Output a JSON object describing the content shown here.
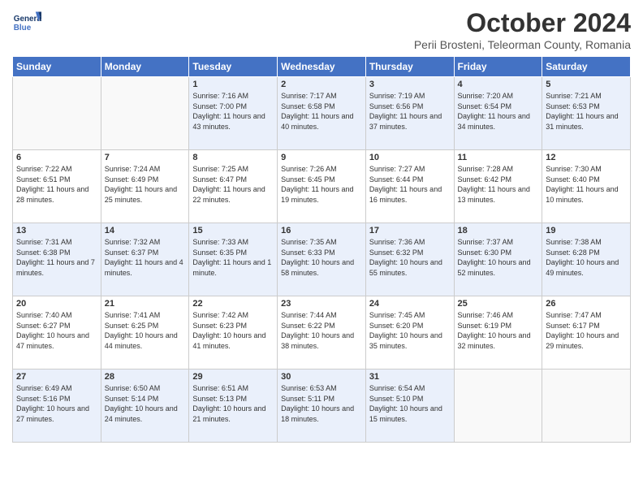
{
  "header": {
    "logo_line1": "General",
    "logo_line2": "Blue",
    "month_title": "October 2024",
    "subtitle": "Perii Brosteni, Teleorman County, Romania"
  },
  "days_of_week": [
    "Sunday",
    "Monday",
    "Tuesday",
    "Wednesday",
    "Thursday",
    "Friday",
    "Saturday"
  ],
  "weeks": [
    [
      {
        "day": "",
        "info": ""
      },
      {
        "day": "",
        "info": ""
      },
      {
        "day": "1",
        "info": "Sunrise: 7:16 AM\nSunset: 7:00 PM\nDaylight: 11 hours and 43 minutes."
      },
      {
        "day": "2",
        "info": "Sunrise: 7:17 AM\nSunset: 6:58 PM\nDaylight: 11 hours and 40 minutes."
      },
      {
        "day": "3",
        "info": "Sunrise: 7:19 AM\nSunset: 6:56 PM\nDaylight: 11 hours and 37 minutes."
      },
      {
        "day": "4",
        "info": "Sunrise: 7:20 AM\nSunset: 6:54 PM\nDaylight: 11 hours and 34 minutes."
      },
      {
        "day": "5",
        "info": "Sunrise: 7:21 AM\nSunset: 6:53 PM\nDaylight: 11 hours and 31 minutes."
      }
    ],
    [
      {
        "day": "6",
        "info": "Sunrise: 7:22 AM\nSunset: 6:51 PM\nDaylight: 11 hours and 28 minutes."
      },
      {
        "day": "7",
        "info": "Sunrise: 7:24 AM\nSunset: 6:49 PM\nDaylight: 11 hours and 25 minutes."
      },
      {
        "day": "8",
        "info": "Sunrise: 7:25 AM\nSunset: 6:47 PM\nDaylight: 11 hours and 22 minutes."
      },
      {
        "day": "9",
        "info": "Sunrise: 7:26 AM\nSunset: 6:45 PM\nDaylight: 11 hours and 19 minutes."
      },
      {
        "day": "10",
        "info": "Sunrise: 7:27 AM\nSunset: 6:44 PM\nDaylight: 11 hours and 16 minutes."
      },
      {
        "day": "11",
        "info": "Sunrise: 7:28 AM\nSunset: 6:42 PM\nDaylight: 11 hours and 13 minutes."
      },
      {
        "day": "12",
        "info": "Sunrise: 7:30 AM\nSunset: 6:40 PM\nDaylight: 11 hours and 10 minutes."
      }
    ],
    [
      {
        "day": "13",
        "info": "Sunrise: 7:31 AM\nSunset: 6:38 PM\nDaylight: 11 hours and 7 minutes."
      },
      {
        "day": "14",
        "info": "Sunrise: 7:32 AM\nSunset: 6:37 PM\nDaylight: 11 hours and 4 minutes."
      },
      {
        "day": "15",
        "info": "Sunrise: 7:33 AM\nSunset: 6:35 PM\nDaylight: 11 hours and 1 minute."
      },
      {
        "day": "16",
        "info": "Sunrise: 7:35 AM\nSunset: 6:33 PM\nDaylight: 10 hours and 58 minutes."
      },
      {
        "day": "17",
        "info": "Sunrise: 7:36 AM\nSunset: 6:32 PM\nDaylight: 10 hours and 55 minutes."
      },
      {
        "day": "18",
        "info": "Sunrise: 7:37 AM\nSunset: 6:30 PM\nDaylight: 10 hours and 52 minutes."
      },
      {
        "day": "19",
        "info": "Sunrise: 7:38 AM\nSunset: 6:28 PM\nDaylight: 10 hours and 49 minutes."
      }
    ],
    [
      {
        "day": "20",
        "info": "Sunrise: 7:40 AM\nSunset: 6:27 PM\nDaylight: 10 hours and 47 minutes."
      },
      {
        "day": "21",
        "info": "Sunrise: 7:41 AM\nSunset: 6:25 PM\nDaylight: 10 hours and 44 minutes."
      },
      {
        "day": "22",
        "info": "Sunrise: 7:42 AM\nSunset: 6:23 PM\nDaylight: 10 hours and 41 minutes."
      },
      {
        "day": "23",
        "info": "Sunrise: 7:44 AM\nSunset: 6:22 PM\nDaylight: 10 hours and 38 minutes."
      },
      {
        "day": "24",
        "info": "Sunrise: 7:45 AM\nSunset: 6:20 PM\nDaylight: 10 hours and 35 minutes."
      },
      {
        "day": "25",
        "info": "Sunrise: 7:46 AM\nSunset: 6:19 PM\nDaylight: 10 hours and 32 minutes."
      },
      {
        "day": "26",
        "info": "Sunrise: 7:47 AM\nSunset: 6:17 PM\nDaylight: 10 hours and 29 minutes."
      }
    ],
    [
      {
        "day": "27",
        "info": "Sunrise: 6:49 AM\nSunset: 5:16 PM\nDaylight: 10 hours and 27 minutes."
      },
      {
        "day": "28",
        "info": "Sunrise: 6:50 AM\nSunset: 5:14 PM\nDaylight: 10 hours and 24 minutes."
      },
      {
        "day": "29",
        "info": "Sunrise: 6:51 AM\nSunset: 5:13 PM\nDaylight: 10 hours and 21 minutes."
      },
      {
        "day": "30",
        "info": "Sunrise: 6:53 AM\nSunset: 5:11 PM\nDaylight: 10 hours and 18 minutes."
      },
      {
        "day": "31",
        "info": "Sunrise: 6:54 AM\nSunset: 5:10 PM\nDaylight: 10 hours and 15 minutes."
      },
      {
        "day": "",
        "info": ""
      },
      {
        "day": "",
        "info": ""
      }
    ]
  ]
}
